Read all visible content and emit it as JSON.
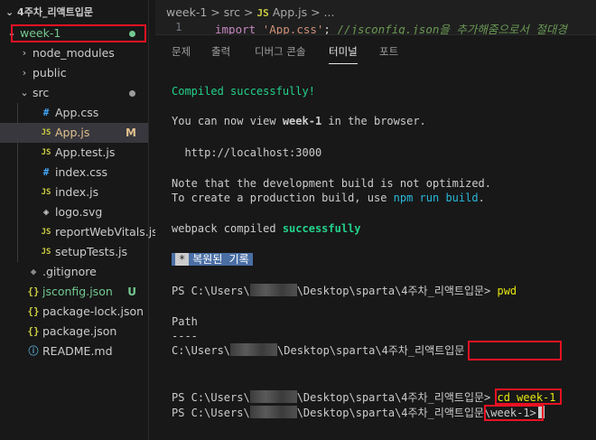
{
  "explorer": {
    "root_title": "4주차_리액트입문",
    "items": [
      {
        "label": "week-1",
        "type": "folder-open",
        "depth": 0,
        "status": "dot-green"
      },
      {
        "label": "node_modules",
        "type": "folder-closed",
        "depth": 1
      },
      {
        "label": "public",
        "type": "folder-closed",
        "depth": 1
      },
      {
        "label": "src",
        "type": "folder-open",
        "depth": 1,
        "status": "dot"
      },
      {
        "label": "App.css",
        "type": "css",
        "depth": 2
      },
      {
        "label": "App.js",
        "type": "js",
        "depth": 2,
        "badge": "M",
        "active": true
      },
      {
        "label": "App.test.js",
        "type": "js",
        "depth": 2
      },
      {
        "label": "index.css",
        "type": "css",
        "depth": 2
      },
      {
        "label": "index.js",
        "type": "js",
        "depth": 2
      },
      {
        "label": "logo.svg",
        "type": "svg",
        "depth": 2
      },
      {
        "label": "reportWebVitals.js",
        "type": "js",
        "depth": 2
      },
      {
        "label": "setupTests.js",
        "type": "js",
        "depth": 2
      },
      {
        "label": ".gitignore",
        "type": "git",
        "depth": 1
      },
      {
        "label": "jsconfig.json",
        "type": "json",
        "depth": 1,
        "badge": "U"
      },
      {
        "label": "package-lock.json",
        "type": "json",
        "depth": 1
      },
      {
        "label": "package.json",
        "type": "json",
        "depth": 1
      },
      {
        "label": "README.md",
        "type": "info",
        "depth": 1
      }
    ]
  },
  "breadcrumb": {
    "folder": "week-1",
    "sep": ">",
    "dir": "src",
    "file_icon": "JS",
    "file": "App.js",
    "more": "..."
  },
  "code": {
    "line_number": "1",
    "keyword": "import",
    "string": "'App.css'",
    "semicolon": ";",
    "comment": "//jsconfig.json을 추가해줌으로서 절대경"
  },
  "panel": {
    "tabs": [
      "문제",
      "출력",
      "디버그 콘솔",
      "터미널",
      "포트"
    ],
    "active_tab": "터미널"
  },
  "terminal": {
    "compiled": "Compiled successfully!",
    "view_prefix": "You can now view ",
    "view_app": "week-1",
    "view_suffix": " in the browser.",
    "url": "  http://localhost:3000",
    "note1": "Note that the development build is not optimized.",
    "note2_prefix": "To create a production build, use ",
    "note2_cmd": "npm run build",
    "note2_suffix": ".",
    "webpack_prefix": "webpack compiled ",
    "webpack_status": "successfully",
    "restored_star": "*",
    "restored_label": "복원된 기록",
    "ps_prefix": "PS C:\\Users\\",
    "ps_suffix": "\\Desktop\\sparta\\4주차_리액트입문> ",
    "cmd_pwd": "pwd",
    "path_header": "Path",
    "path_rule": "----",
    "path_prefix": "C:\\Users\\",
    "path_suffix": "\\Desktop\\sparta\\4주차_리액트입문",
    "cmd_cd": "cd week-1",
    "ps_suffix_noprompt": "\\Desktop\\sparta\\4주차_리액트입문",
    "week_prompt": "\\week-1>"
  }
}
